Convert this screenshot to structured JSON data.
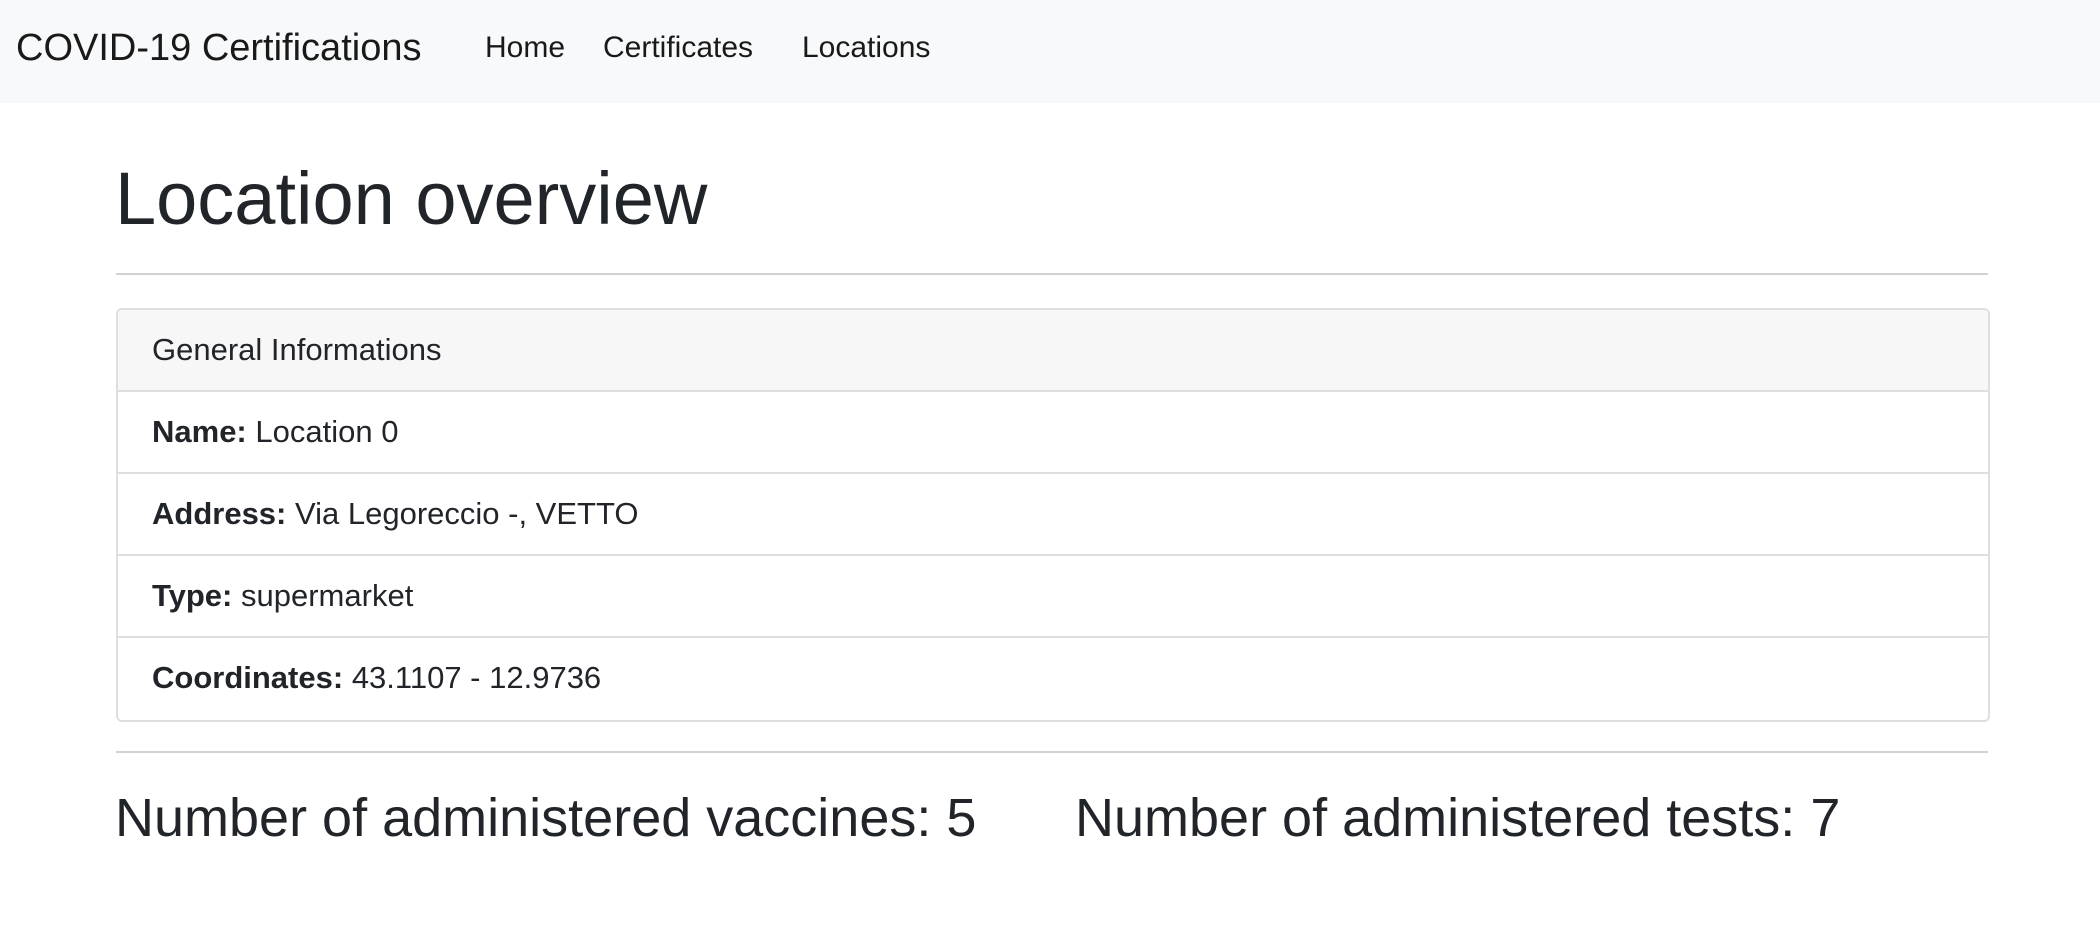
{
  "navbar": {
    "brand": "COVID-19 Certifications",
    "links": [
      {
        "label": "Home"
      },
      {
        "label": "Certificates"
      },
      {
        "label": "Locations"
      }
    ]
  },
  "page": {
    "title": "Location overview"
  },
  "general_info": {
    "header": "General Informations",
    "fields": [
      {
        "label": "Name:",
        "value": "Location 0"
      },
      {
        "label": "Address:",
        "value": "Via Legoreccio -, VETTO"
      },
      {
        "label": "Type:",
        "value": "supermarket"
      },
      {
        "label": "Coordinates:",
        "value": "43.1107 - 12.9736"
      }
    ]
  },
  "stats": {
    "vaccines_label": "Number of administered vaccines:",
    "vaccines_count": "5",
    "tests_label": "Number of administered tests:",
    "tests_count": "7"
  }
}
